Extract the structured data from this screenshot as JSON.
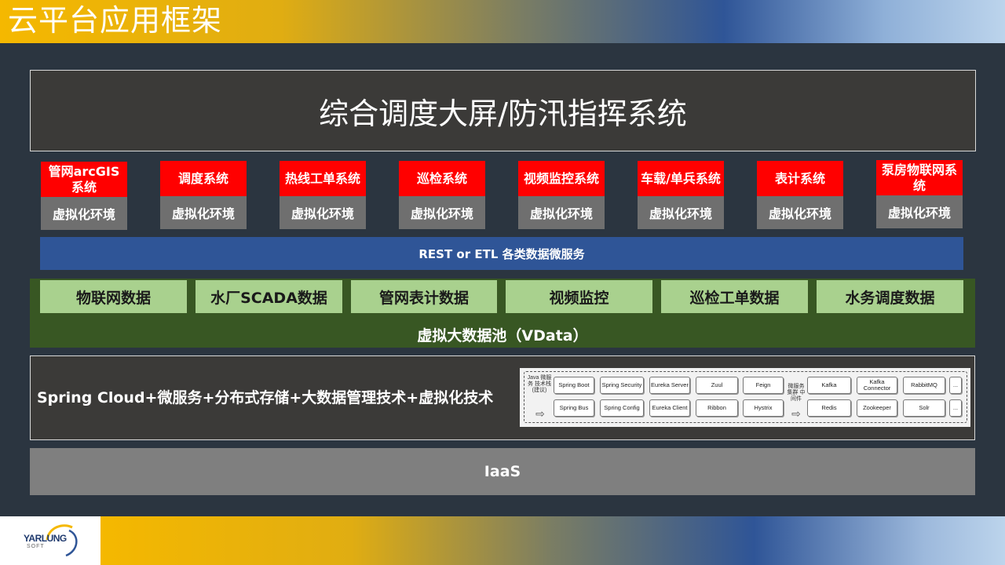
{
  "slide": {
    "title": "云平台应用框架"
  },
  "top_system": {
    "label": "综合调度大屏/防汛指挥系统"
  },
  "subsystems": [
    {
      "name": "管网arcGIS系统",
      "env": "虚拟化环境"
    },
    {
      "name": "调度系统",
      "env": "虚拟化环境"
    },
    {
      "name": "热线工单系统",
      "env": "虚拟化环境"
    },
    {
      "name": "巡检系统",
      "env": "虚拟化环境"
    },
    {
      "name": "视频监控系统",
      "env": "虚拟化环境"
    },
    {
      "name": "车载/单兵系统",
      "env": "虚拟化环境"
    },
    {
      "name": "表计系统",
      "env": "虚拟化环境"
    },
    {
      "name": "泵房物联网系统",
      "env": "虚拟化环境"
    }
  ],
  "services_bar": {
    "label": "REST or ETL 各类数据微服务"
  },
  "vdata": {
    "boxes": [
      "物联网数据",
      "水厂SCADA数据",
      "管网表计数据",
      "视频监控",
      "巡检工单数据",
      "水务调度数据"
    ],
    "title": "虚拟大数据池（VData）"
  },
  "tech": {
    "text": "Spring Cloud+微服务+分布式存储+大数据管理技术+虚拟化技术",
    "stack_left_label": "Java 微服务 技术栈 (建议)",
    "stack_mid_label": "微服务 集群 中间件",
    "row1": [
      "Spring Boot",
      "Spring Security",
      "Eureka Server",
      "Zuul",
      "Feign"
    ],
    "row2": [
      "Spring Bus",
      "Spring Config",
      "Eureka Client",
      "Ribbon",
      "Hystrix"
    ],
    "mw_row1": [
      "Kafka",
      "Kafka Connector",
      "RabbitMQ",
      "..."
    ],
    "mw_row2": [
      "Redis",
      "Zookeeper",
      "Solr",
      "..."
    ]
  },
  "iaas": {
    "label": "IaaS"
  },
  "footer": {
    "logo": "YARLUNG",
    "logo_sub": "SOFT"
  },
  "colors": {
    "header_yellow": "#f5b800",
    "header_blue": "#2f5597",
    "system_red": "#ff0000",
    "env_gray": "#6f6f6f",
    "vdata_green": "#385723",
    "vdata_box": "#a9d18e",
    "iaas_gray": "#7f7f7f"
  }
}
